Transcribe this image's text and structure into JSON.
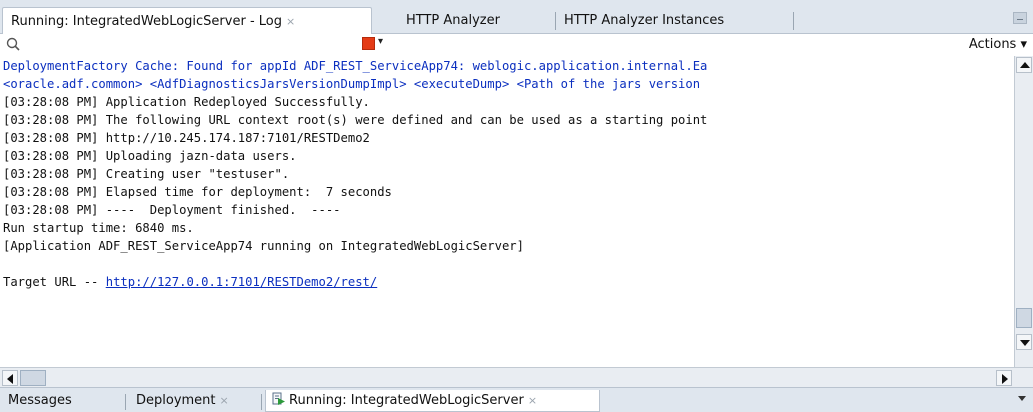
{
  "tabs": [
    {
      "label": "Running: IntegratedWebLogicServer - Log",
      "close": "×"
    },
    {
      "label": "HTTP Analyzer"
    },
    {
      "label": "HTTP Analyzer Instances"
    }
  ],
  "toolbar": {
    "search_value": "",
    "actions_label": "Actions ▾",
    "stop_dropdown": "▾"
  },
  "log": {
    "lines": [
      "DeploymentFactory Cache: Found for appId ADF_REST_ServiceApp74: weblogic.application.internal.Ea",
      "<oracle.adf.common> <AdfDiagnosticsJarsVersionDumpImpl> <executeDump> <Path of the jars version",
      "[03:28:08 PM] Application Redeployed Successfully.",
      "[03:28:08 PM] The following URL context root(s) were defined and can be used as a starting point",
      "[03:28:08 PM] http://10.245.174.187:7101/RESTDemo2",
      "[03:28:08 PM] Uploading jazn-data users.",
      "[03:28:08 PM] Creating user \"testuser\".",
      "[03:28:08 PM] Elapsed time for deployment:  7 seconds",
      "[03:28:08 PM] ----  Deployment finished.  ----",
      "Run startup time: 6840 ms.",
      "[Application ADF_REST_ServiceApp74 running on IntegratedWebLogicServer]",
      ""
    ],
    "target_prefix": "Target URL -- ",
    "target_url": "http://127.0.0.1:7101/RESTDemo2/rest/"
  },
  "bottom_tabs": [
    {
      "label": "Messages"
    },
    {
      "label": "Deployment",
      "close": "×"
    },
    {
      "label": "Running: IntegratedWebLogicServer",
      "close": "×"
    }
  ],
  "colors": {
    "log_blue": "#0b2fbf",
    "stop_red": "#e43b16"
  }
}
